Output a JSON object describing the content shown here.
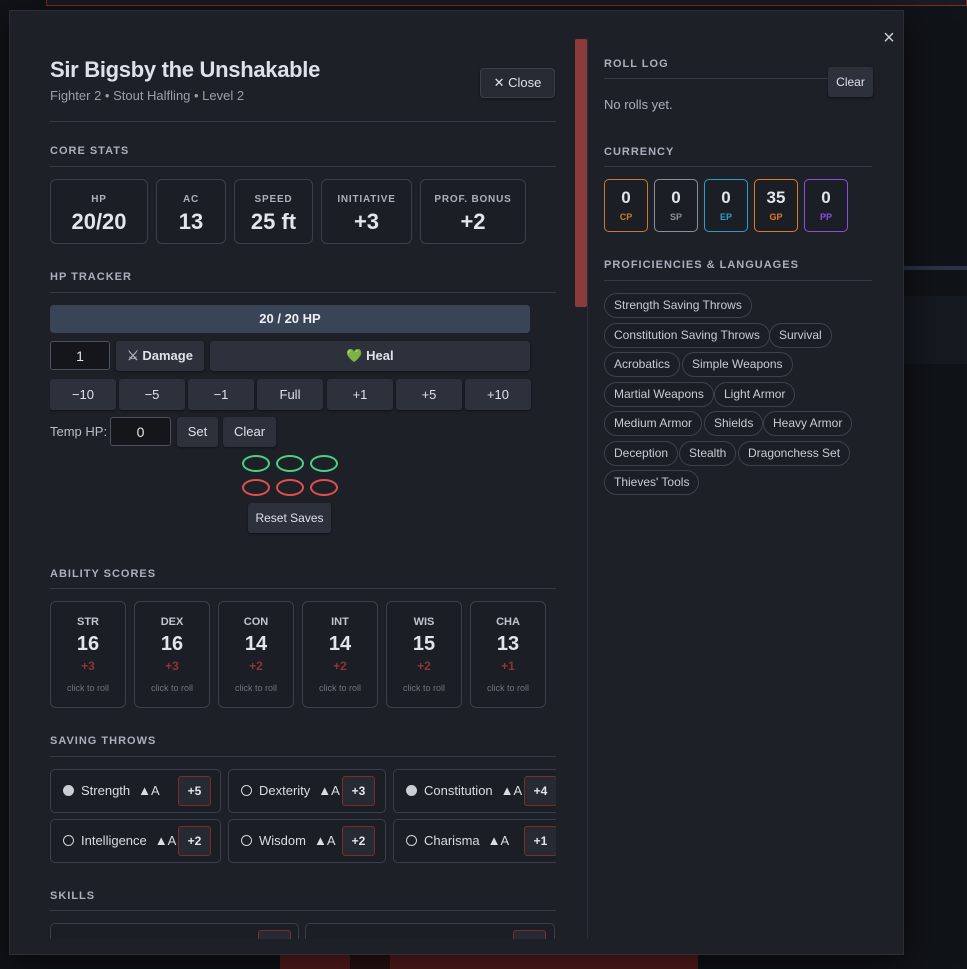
{
  "character": {
    "name": "Sir Bigsby the Unshakable",
    "subtitle": "Fighter 2 • Stout Halfling • Level 2",
    "close_label": "Close"
  },
  "modal": {
    "close_glyph": "×"
  },
  "core_stats": {
    "title": "CORE STATS",
    "items": [
      {
        "label": "HP",
        "value": "20/20"
      },
      {
        "label": "AC",
        "value": "13"
      },
      {
        "label": "SPEED",
        "value": "25 ft"
      },
      {
        "label": "INITIATIVE",
        "value": "+3"
      },
      {
        "label": "PROF. BONUS",
        "value": "+2"
      }
    ]
  },
  "hp_tracker": {
    "title": "HP TRACKER",
    "bar_text": "20 / 20 HP",
    "bar_fraction": 1.0,
    "amount_value": "1",
    "damage_label": "Damage",
    "damage_icon": "⚔",
    "heal_label": "Heal",
    "heal_icon": "💚",
    "quick_buttons": [
      "−10",
      "−5",
      "−1",
      "Full",
      "+1",
      "+5",
      "+10"
    ],
    "temp_label": "Temp HP:",
    "temp_value": "0",
    "set_label": "Set",
    "clear_label": "Clear",
    "death_saves": {
      "successes": 0,
      "failures": 0,
      "count": 3
    },
    "reset_label": "Reset Saves"
  },
  "ability_scores": {
    "title": "ABILITY SCORES",
    "hint": "click to roll",
    "items": [
      {
        "abbr": "STR",
        "score": "16",
        "mod": "+3"
      },
      {
        "abbr": "DEX",
        "score": "16",
        "mod": "+3"
      },
      {
        "abbr": "CON",
        "score": "14",
        "mod": "+2"
      },
      {
        "abbr": "INT",
        "score": "14",
        "mod": "+2"
      },
      {
        "abbr": "WIS",
        "score": "15",
        "mod": "+2"
      },
      {
        "abbr": "CHA",
        "score": "13",
        "mod": "+1"
      }
    ]
  },
  "saving_throws": {
    "title": "SAVING THROWS",
    "adv_label": "▲A",
    "items": [
      {
        "name": "Strength",
        "bonus": "+5",
        "proficient": true
      },
      {
        "name": "Dexterity",
        "bonus": "+3",
        "proficient": false
      },
      {
        "name": "Constitution",
        "bonus": "+4",
        "proficient": true
      },
      {
        "name": "Intelligence",
        "bonus": "+2",
        "proficient": false
      },
      {
        "name": "Wisdom",
        "bonus": "+2",
        "proficient": false
      },
      {
        "name": "Charisma",
        "bonus": "+1",
        "proficient": false
      }
    ]
  },
  "skills": {
    "title": "SKILLS"
  },
  "roll_log": {
    "title": "ROLL LOG",
    "clear_label": "Clear",
    "empty_text": "No rolls yet."
  },
  "currency": {
    "title": "CURRENCY",
    "coins": [
      {
        "label": "CP",
        "value": "0",
        "color": "#c77d2b"
      },
      {
        "label": "SP",
        "value": "0",
        "color": "#8a9099"
      },
      {
        "label": "EP",
        "value": "0",
        "color": "#2b9fc7"
      },
      {
        "label": "GP",
        "value": "35",
        "color": "#e07b1f"
      },
      {
        "label": "PP",
        "value": "0",
        "color": "#8b4fe0"
      }
    ]
  },
  "proficiencies": {
    "title": "PROFICIENCIES & LANGUAGES",
    "chips": [
      "Strength Saving Throws",
      "Constitution Saving Throws",
      "Survival",
      "Acrobatics",
      "Simple Weapons",
      "Martial Weapons",
      "Light Armor",
      "Medium Armor",
      "Shields",
      "Heavy Armor",
      "Deception",
      "Stealth",
      "Dragonchess Set",
      "Thieves' Tools"
    ]
  }
}
